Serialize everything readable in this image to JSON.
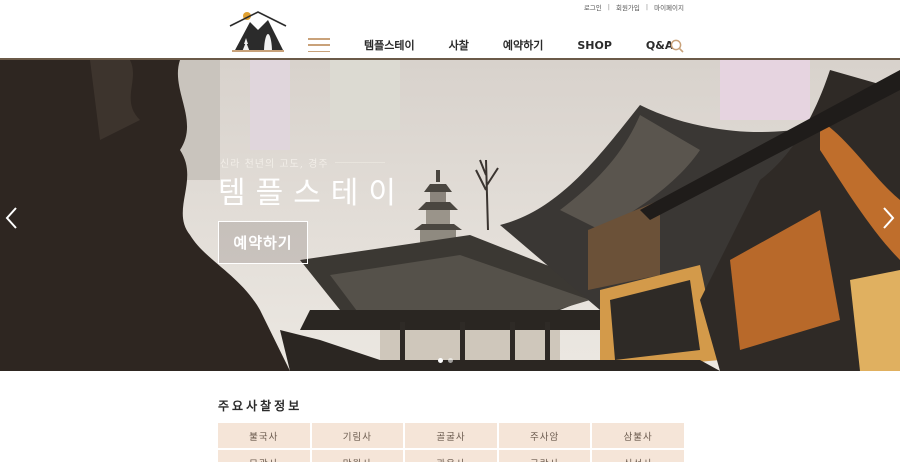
{
  "header": {
    "util_links": [
      "로그인",
      "회원가입",
      "마이페이지"
    ],
    "util_separator": "|",
    "nav_items": [
      "템플스테이",
      "사찰",
      "예약하기",
      "SHOP",
      "Q&A"
    ],
    "icons": [
      "logo-temple-mountain",
      "menu-icon",
      "search-icon"
    ]
  },
  "hero": {
    "subtitle": "신라 천년의 고도, 경주",
    "title": "템플스테이",
    "cta_label": "예약하기",
    "slides_count": 2,
    "active_slide": 0,
    "icons": [
      "chevron-left-icon",
      "chevron-right-icon"
    ]
  },
  "temples": {
    "section_title": "주요사찰정보",
    "items": [
      "불국사",
      "기림사",
      "골굴사",
      "주사암",
      "삼불사",
      "묘광사",
      "망월사",
      "관음사",
      "극락사",
      "신선사"
    ]
  },
  "colors": {
    "accent": "#c9a27a",
    "header_line": "#6b5a48",
    "cell_bg": "#f5e5d8",
    "text": "#2b2b2b"
  }
}
